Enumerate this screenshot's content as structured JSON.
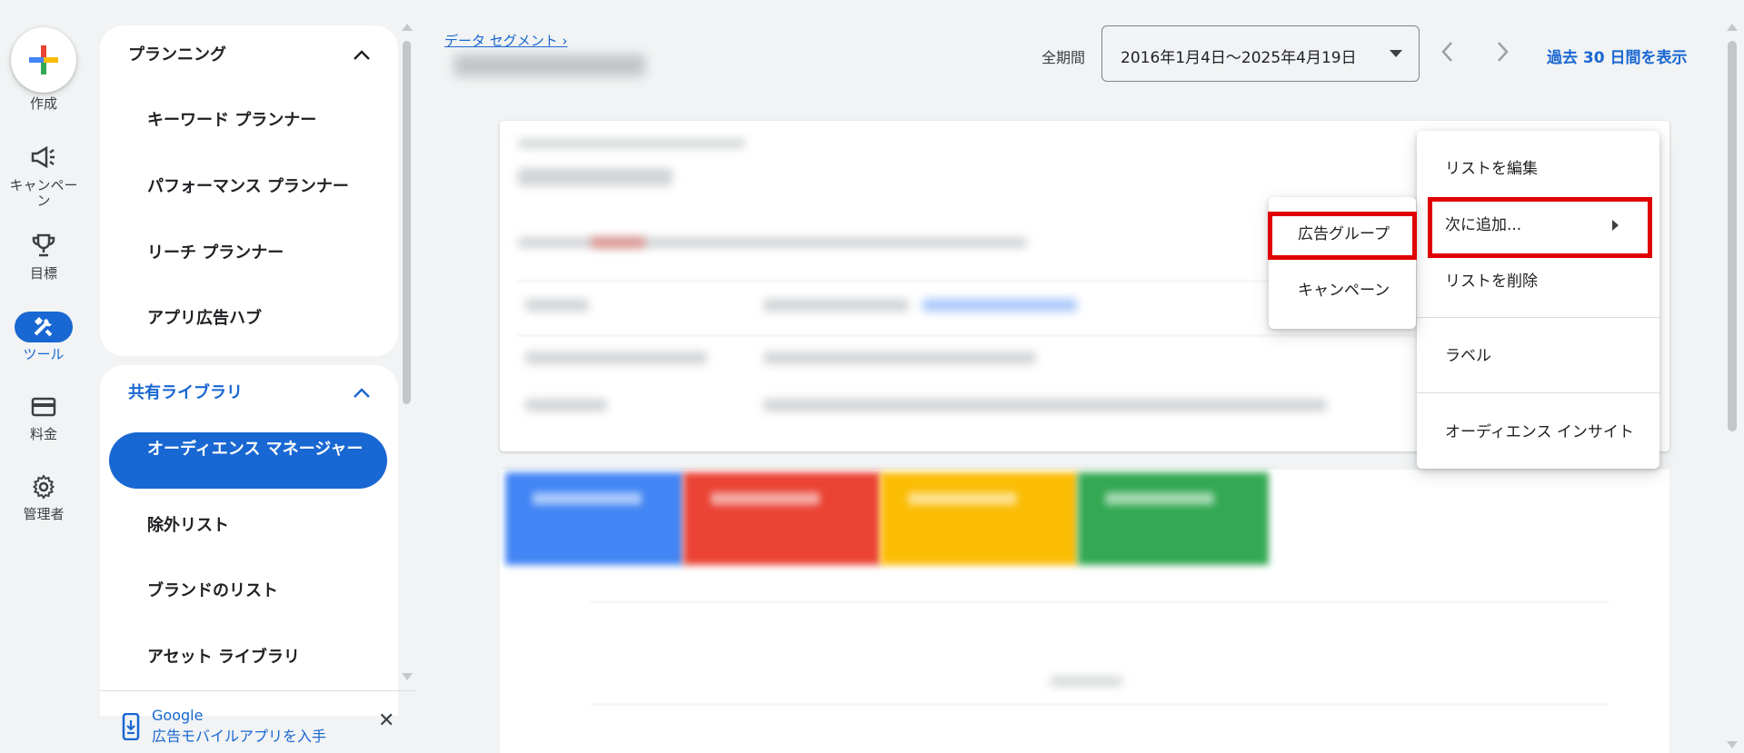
{
  "rail": {
    "create_label": "作成",
    "campaign_label": "キャンペー\nン",
    "goals_label": "目標",
    "tools_label": "ツール",
    "billing_label": "料金",
    "admin_label": "管理者"
  },
  "nav": {
    "planning": {
      "heading": "プランニング",
      "items": [
        "キーワード プランナー",
        "パフォーマンス プランナー",
        "リーチ プランナー",
        "アプリ広告ハブ"
      ]
    },
    "shared_library": {
      "heading": "共有ライブラリ",
      "active_item": "オーディエンス マネージャー",
      "items": [
        "除外リスト",
        "ブランドのリスト",
        "アセット ライブラリ"
      ]
    },
    "promo": {
      "line1": "Google",
      "line2": "広告モバイルアプリを入手"
    }
  },
  "header": {
    "breadcrumb": "データ セグメント ›",
    "period_label": "全期間",
    "date_range": "2016年1月4日〜2025年4月19日",
    "last30_link": "過去 30 日間を表示"
  },
  "menu": {
    "edit_list": "リストを編集",
    "add_to": "次に追加...",
    "delete_list": "リストを削除",
    "label": "ラベル",
    "audience_insights": "オーディエンス インサイト"
  },
  "submenu": {
    "ad_group": "広告グループ",
    "campaign": "キャンペーン"
  },
  "colors": {
    "accent": "#1967d2",
    "highlight": "#e00000",
    "tile_blue": "#4285f4",
    "tile_red": "#ea4335",
    "tile_yellow": "#fbbc04",
    "tile_green": "#34a853"
  }
}
